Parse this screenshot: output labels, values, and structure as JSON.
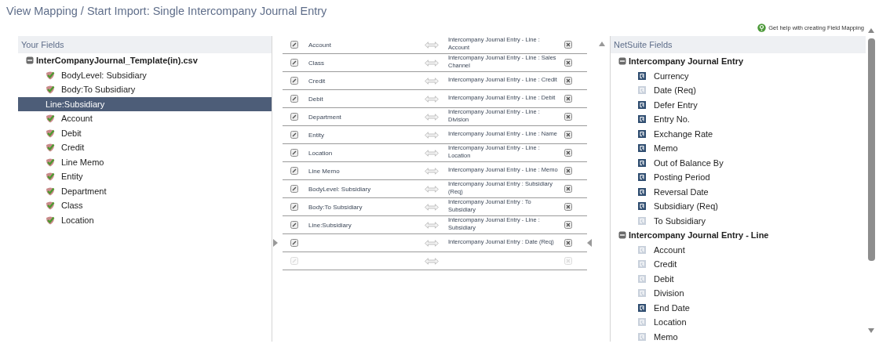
{
  "title": "View Mapping / Start Import: Single Intercompany Journal Entry",
  "help_link": "Get help with creating Field Mapping",
  "your_fields": {
    "header": "Your Fields",
    "file": {
      "label": "InterCompanyJournal_Template(in).csv",
      "expanded": true,
      "children": [
        {
          "label": "BodyLevel: Subsidiary",
          "selected": false
        },
        {
          "label": "Body:To Subsidiary",
          "selected": false
        },
        {
          "label": "Line:Subsidiary",
          "selected": true
        },
        {
          "label": "Account",
          "selected": false
        },
        {
          "label": "Debit",
          "selected": false
        },
        {
          "label": "Credit",
          "selected": false
        },
        {
          "label": "Line Memo",
          "selected": false
        },
        {
          "label": "Entity",
          "selected": false
        },
        {
          "label": "Department",
          "selected": false
        },
        {
          "label": "Class",
          "selected": false
        },
        {
          "label": "Location",
          "selected": false
        }
      ]
    }
  },
  "mappings": [
    {
      "source": "Account",
      "target": "Intercompany Journal Entry - Line : Account",
      "disabled": false
    },
    {
      "source": "Class",
      "target": "Intercompany Journal Entry - Line : Sales Channel",
      "disabled": false
    },
    {
      "source": "Credit",
      "target": "Intercompany Journal Entry - Line : Credit",
      "disabled": false
    },
    {
      "source": "Debit",
      "target": "Intercompany Journal Entry - Line : Debit",
      "disabled": false
    },
    {
      "source": "Department",
      "target": "Intercompany Journal Entry - Line : Division",
      "disabled": false
    },
    {
      "source": "Entity",
      "target": "Intercompany Journal Entry - Line : Name",
      "disabled": false
    },
    {
      "source": "Location",
      "target": "Intercompany Journal Entry - Line : Location",
      "disabled": false
    },
    {
      "source": "Line Memo",
      "target": "Intercompany Journal Entry - Line : Memo",
      "disabled": false
    },
    {
      "source": "BodyLevel: Subsidiary",
      "target": "Intercompany Journal Entry : Subsidiary (Req)",
      "disabled": false
    },
    {
      "source": "Body:To Subsidiary",
      "target": "Intercompany Journal Entry : To Subsidiary",
      "disabled": false
    },
    {
      "source": "Line:Subsidiary",
      "target": "Intercompany Journal Entry - Line : Subsidiary",
      "disabled": false
    },
    {
      "target": "Intercompany Journal Entry : Date (Req)",
      "disabled": false
    },
    {
      "disabled": true
    }
  ],
  "netsuite_fields": {
    "header": "NetSuite Fields",
    "groups": [
      {
        "label": "Intercompany Journal Entry",
        "expanded": true,
        "children": [
          {
            "label": "Currency",
            "mapped": false
          },
          {
            "label": "Date (Req)",
            "mapped": true
          },
          {
            "label": "Defer Entry",
            "mapped": false
          },
          {
            "label": "Entry No.",
            "mapped": false
          },
          {
            "label": "Exchange Rate",
            "mapped": false
          },
          {
            "label": "Memo",
            "mapped": false
          },
          {
            "label": "Out of Balance By",
            "mapped": false
          },
          {
            "label": "Posting Period",
            "mapped": false
          },
          {
            "label": "Reversal Date",
            "mapped": false
          },
          {
            "label": "Subsidiary (Req)",
            "mapped": false
          },
          {
            "label": "To Subsidiary",
            "mapped": true
          }
        ]
      },
      {
        "label": "Intercompany Journal Entry - Line",
        "expanded": true,
        "children": [
          {
            "label": "Account",
            "mapped": true
          },
          {
            "label": "Credit",
            "mapped": true
          },
          {
            "label": "Debit",
            "mapped": true
          },
          {
            "label": "Division",
            "mapped": true
          },
          {
            "label": "End Date",
            "mapped": false
          },
          {
            "label": "Location",
            "mapped": true
          },
          {
            "label": "Memo",
            "mapped": true
          }
        ]
      }
    ]
  }
}
